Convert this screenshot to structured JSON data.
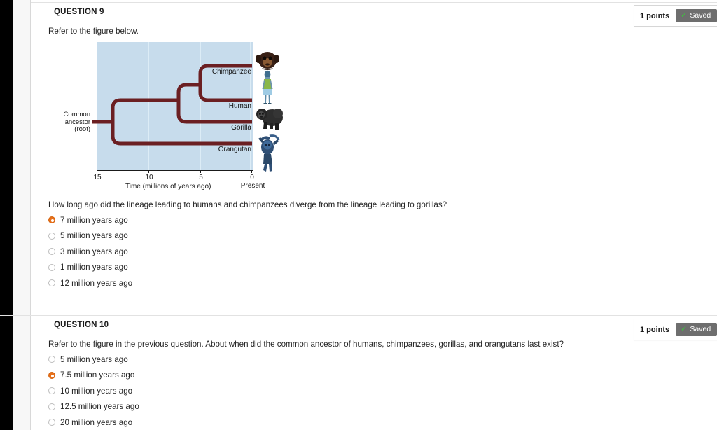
{
  "colors": {
    "selected_radio": "#e8701a",
    "saved_button_bg": "#6e6e6e",
    "saved_check": "#3ec13e",
    "chart_bg": "#c7dcec",
    "branch": "#6b1f22",
    "gridline": "#dcecf6"
  },
  "questions": [
    {
      "heading": "QUESTION 9",
      "points_label": "1 points",
      "saved_label": "Saved",
      "saved_icon": "check-icon",
      "prompt_intro": "Refer to the figure below.",
      "prompt": "How long ago did the lineage leading to humans and chimpanzees diverge from the lineage leading to gorillas?",
      "options": [
        {
          "label": "7 million years ago",
          "selected": true
        },
        {
          "label": "5 million years ago",
          "selected": false
        },
        {
          "label": "3 million years ago",
          "selected": false
        },
        {
          "label": "1 million years ago",
          "selected": false
        },
        {
          "label": "12 million years ago",
          "selected": false
        }
      ]
    },
    {
      "heading": "QUESTION 10",
      "points_label": "1 points",
      "saved_label": "Saved",
      "saved_icon": "check-icon",
      "prompt": "Refer to the figure in the previous question. About when did the common ancestor of humans, chimpanzees, gorillas, and orangutans last exist?",
      "options": [
        {
          "label": "5 million years ago",
          "selected": false
        },
        {
          "label": "7.5 million years ago",
          "selected": true
        },
        {
          "label": "10 million years ago",
          "selected": false
        },
        {
          "label": "12.5 million years ago",
          "selected": false
        },
        {
          "label": "20 million years ago",
          "selected": false
        }
      ]
    }
  ],
  "chart_data": {
    "type": "diagram",
    "subtype": "phylogenetic-tree",
    "title": "",
    "xlabel": "Time (millions of years ago)",
    "ylabel": "",
    "xlim": [
      15,
      0
    ],
    "xticks": [
      15,
      10,
      5,
      0
    ],
    "xticklabels": [
      "15",
      "10",
      "5",
      "0"
    ],
    "present_label": "Present",
    "root_label": "Common\nancestor\n(root)",
    "root_label_lines": [
      "Common",
      "ancestor",
      "(root)"
    ],
    "grid": true,
    "taxa": [
      {
        "name": "Chimpanzee",
        "icon": "chimpanzee-image",
        "tip_time": 0
      },
      {
        "name": "Human",
        "icon": "human-image",
        "tip_time": 0
      },
      {
        "name": "Gorilla",
        "icon": "gorilla-image",
        "tip_time": 0
      },
      {
        "name": "Orangutan",
        "icon": "orangutan-image",
        "tip_time": 0
      }
    ],
    "nodes": [
      {
        "name": "root",
        "time": 13.5,
        "children": [
          "orangutan",
          "african-apes"
        ]
      },
      {
        "name": "african-apes",
        "time": 7.0,
        "children": [
          "gorilla",
          "human-chimp"
        ]
      },
      {
        "name": "human-chimp",
        "time": 5.0,
        "children": [
          "chimpanzee",
          "human"
        ]
      }
    ],
    "annotations": [
      "Root (common ancestor of all four) at about 13.5 million years ago",
      "Gorilla lineage splits from human-chimpanzee lineage at about 7 million years ago",
      "Human and chimpanzee lineages split at about 5 million years ago"
    ]
  }
}
